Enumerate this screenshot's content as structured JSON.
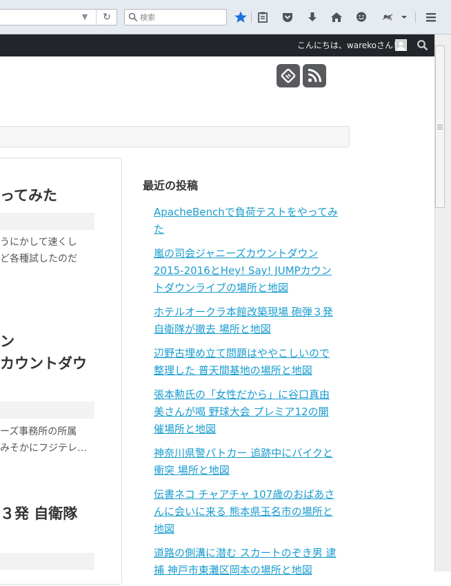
{
  "browser": {
    "search_placeholder": "検索",
    "accent": "#1a73d9"
  },
  "admin_bar": {
    "greeting": "こんにちは、warekoさん！"
  },
  "posts": [
    {
      "title_line1": "ってみた",
      "title_line2": "",
      "excerpt_line1": "うにかして速くし",
      "excerpt_line2": "ど各種試したのだ"
    },
    {
      "title_line1": "ン",
      "title_line2": "カウントダウ",
      "excerpt_line1": "ーズ事務所の所属",
      "excerpt_line2": "みそかにフジテレ…"
    },
    {
      "title_line1": "３発 自衛隊",
      "title_line2": "",
      "excerpt_line1": "",
      "excerpt_line2": ""
    }
  ],
  "sidebar": {
    "recent_title": "最近の投稿",
    "link_color": "#1a9ccf",
    "recent_posts": [
      {
        "line1": "ApacheBenchで負荷テストをやってみ",
        "line2": "た",
        "line3": ""
      },
      {
        "line1": "嵐の司会ジャニーズカウントダウン",
        "line2": "2015-2016とHey! Say! JUMPカウン",
        "line3": "トダウンライブの場所と地図"
      },
      {
        "line1": "ホテルオークラ本館改築現場 砲弾３発",
        "line2": "自衛隊が撤去 場所と地図",
        "line3": ""
      },
      {
        "line1": "辺野古埋め立て問題はややこしいので",
        "line2": "整理した 普天間基地の場所と地図",
        "line3": ""
      },
      {
        "line1": "張本勲氏の「女性だから」に谷口真由",
        "line2": "美さんが喝 野球大会 プレミア12の開",
        "line3": "催場所と地図"
      },
      {
        "line1": "神奈川県警パトカー 追跡中にバイクと",
        "line2": "衝突 場所と地図",
        "line3": ""
      },
      {
        "line1": "伝書ネコ チャアチャ 107歳のおばあさ",
        "line2": "んに会いに来る 熊本県玉名市の場所と",
        "line3": "地図"
      },
      {
        "line1": "道路の側溝に潜む スカートのぞき男 逮",
        "line2": "捕 神戸市東灘区岡本の場所と地図",
        "line3": ""
      }
    ]
  }
}
